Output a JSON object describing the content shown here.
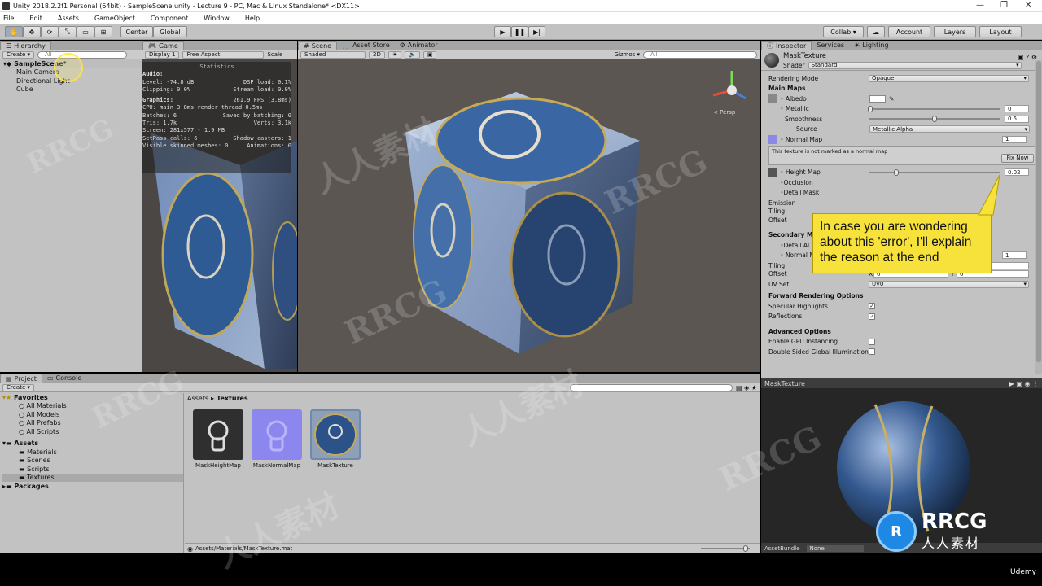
{
  "window": {
    "title": "Unity 2018.2.2f1 Personal (64bit) - SampleScene.unity - Lecture 9 - PC, Mac & Linux Standalone* <DX11>",
    "minimize": "—",
    "maximize": "❐",
    "close": "✕"
  },
  "menu": [
    "File",
    "Edit",
    "Assets",
    "GameObject",
    "Component",
    "Window",
    "Help"
  ],
  "toolbar": {
    "center": "Center",
    "global": "Global",
    "collab": "Collab ▾",
    "account": "Account",
    "layers": "Layers",
    "layout": "Layout"
  },
  "hierarchy": {
    "tab": "Hierarchy",
    "create": "Create ▾",
    "search_placeholder": "All",
    "scene": "SampleScene*",
    "items": [
      "Main Camera",
      "Directional Light",
      "Cube"
    ]
  },
  "game": {
    "tab": "Game",
    "display": "Display 1",
    "aspect": "Free Aspect",
    "scale": "Scale",
    "stats": {
      "header": "Statistics",
      "audio": "Audio:",
      "level": "Level: -74.8 dB",
      "dsp": "DSP load: 0.1%",
      "clipping": "Clipping: 0.0%",
      "stream": "Stream load: 0.0%",
      "graphics": "Graphics:",
      "fps": "261.9 FPS (3.8ms)",
      "cpu": "CPU: main 3.8ms  render thread 0.5ms",
      "batches": "Batches: 6",
      "saved": "Saved by batching: 0",
      "tris": "Tris: 1.7k",
      "verts": "Verts: 3.1k",
      "screen": "Screen: 281x577 - 1.9 MB",
      "setpass": "SetPass calls: 6",
      "shadow": "Shadow casters: 1",
      "skinned": "Visible skinned meshes: 0",
      "anim": "Animations: 0"
    }
  },
  "scene": {
    "tab": "Scene",
    "asset_store": "Asset Store",
    "animator": "Animator",
    "shaded": "Shaded",
    "mode2d": "2D",
    "gizmos": "Gizmos ▾",
    "search_placeholder": "All",
    "persp": "< Persp"
  },
  "inspector": {
    "tab": "Inspector",
    "services": "Services",
    "lighting": "Lighting",
    "material_name": "MaskTexture",
    "shader_label": "Shader",
    "shader_value": "Standard",
    "rendering_mode_label": "Rendering Mode",
    "rendering_mode_value": "Opaque",
    "main_maps": "Main Maps",
    "albedo": "Albedo",
    "metallic": "Metallic",
    "metallic_value": "0",
    "smoothness": "Smoothness",
    "smoothness_value": "0.5",
    "source": "Source",
    "source_value": "Metallic Alpha",
    "normal_map": "Normal Map",
    "normal_value": "1",
    "warning": "This texture is not marked as a normal map",
    "fix_now": "Fix Now",
    "height_map": "Height Map",
    "height_value": "0.02",
    "occlusion": "Occlusion",
    "detail_mask": "Detail Mask",
    "emission": "Emission",
    "tiling": "Tiling",
    "offset": "Offset",
    "secondary": "Secondary M",
    "detail_albedo": "Detail Al",
    "normal_map2": "Normal M",
    "normal2_value": "1",
    "tiling2": "Tiling",
    "offset2": "Offset",
    "tx": "1",
    "ty": "1",
    "ox": "0",
    "oy": "0",
    "uv_set": "UV Set",
    "uv_value": "UV0",
    "forward": "Forward Rendering Options",
    "specular": "Specular Highlights",
    "reflections": "Reflections",
    "advanced": "Advanced Options",
    "gpu_instancing": "Enable GPU Instancing",
    "double_sided": "Double Sided Global Illumination",
    "preview_title": "MaskTexture",
    "asset_bundle": "AssetBundle",
    "asset_bundle_value": "None"
  },
  "callout": "In case you are wondering about this 'error', I'll explain the reason at the end",
  "project": {
    "tab": "Project",
    "console": "Console",
    "create": "Create ▾",
    "favorites": "Favorites",
    "fav_items": [
      "All Materials",
      "All Models",
      "All Prefabs",
      "All Scripts"
    ],
    "assets": "Assets",
    "asset_items": [
      "Materials",
      "Scenes",
      "Scripts",
      "Textures"
    ],
    "packages": "Packages",
    "breadcrumb_root": "Assets",
    "breadcrumb_sep": "▸",
    "breadcrumb_current": "Textures",
    "thumbs": [
      "MaskHeightMap",
      "MaskNormalMap",
      "MaskTexture"
    ],
    "status_path": "Assets/Materials/MaskTexture.mat"
  },
  "watermark": {
    "rrcg": "RRCG",
    "cn": "人人素材",
    "udemy": "Udemy"
  }
}
